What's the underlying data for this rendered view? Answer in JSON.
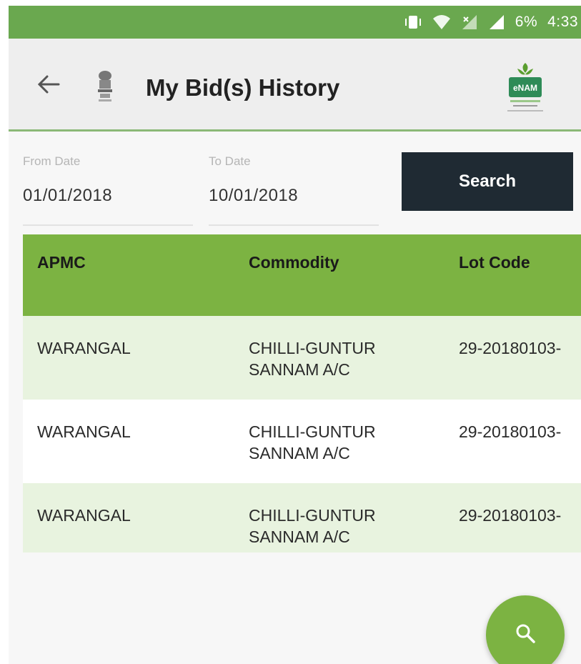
{
  "status_bar": {
    "battery": "6%",
    "time": "4:33",
    "icons": [
      "vibrate-icon",
      "wifi-icon",
      "no-sim-signal-icon",
      "signal-icon"
    ]
  },
  "app_bar": {
    "title": "My Bid(s) History",
    "back_icon": "arrow-left-icon",
    "emblem_icon": "national-emblem-icon",
    "logo_text": "eNAM"
  },
  "filters": {
    "from_label": "From Date",
    "from_value": "01/01/2018",
    "to_label": "To Date",
    "to_value": "10/01/2018",
    "search_label": "Search"
  },
  "table": {
    "headers": [
      "APMC",
      "Commodity",
      "Lot Code"
    ],
    "rows": [
      {
        "apmc": "WARANGAL",
        "commodity_line1": "CHILLI-GUNTUR",
        "commodity_line2": "SANNAM A/C",
        "lot_code": "29-20180103-"
      },
      {
        "apmc": "WARANGAL",
        "commodity_line1": "CHILLI-GUNTUR",
        "commodity_line2": "SANNAM A/C",
        "lot_code": "29-20180103-"
      },
      {
        "apmc": "WARANGAL",
        "commodity_line1": "CHILLI-GUNTUR",
        "commodity_line2": "SANNAM A/C",
        "lot_code": "29-20180103-"
      }
    ]
  },
  "fab": {
    "icon": "search-icon"
  },
  "colors": {
    "accent_green": "#7cb342",
    "status_green": "#6aa84f",
    "row_alt": "#e8f3df",
    "button_dark": "#1f2a33"
  }
}
